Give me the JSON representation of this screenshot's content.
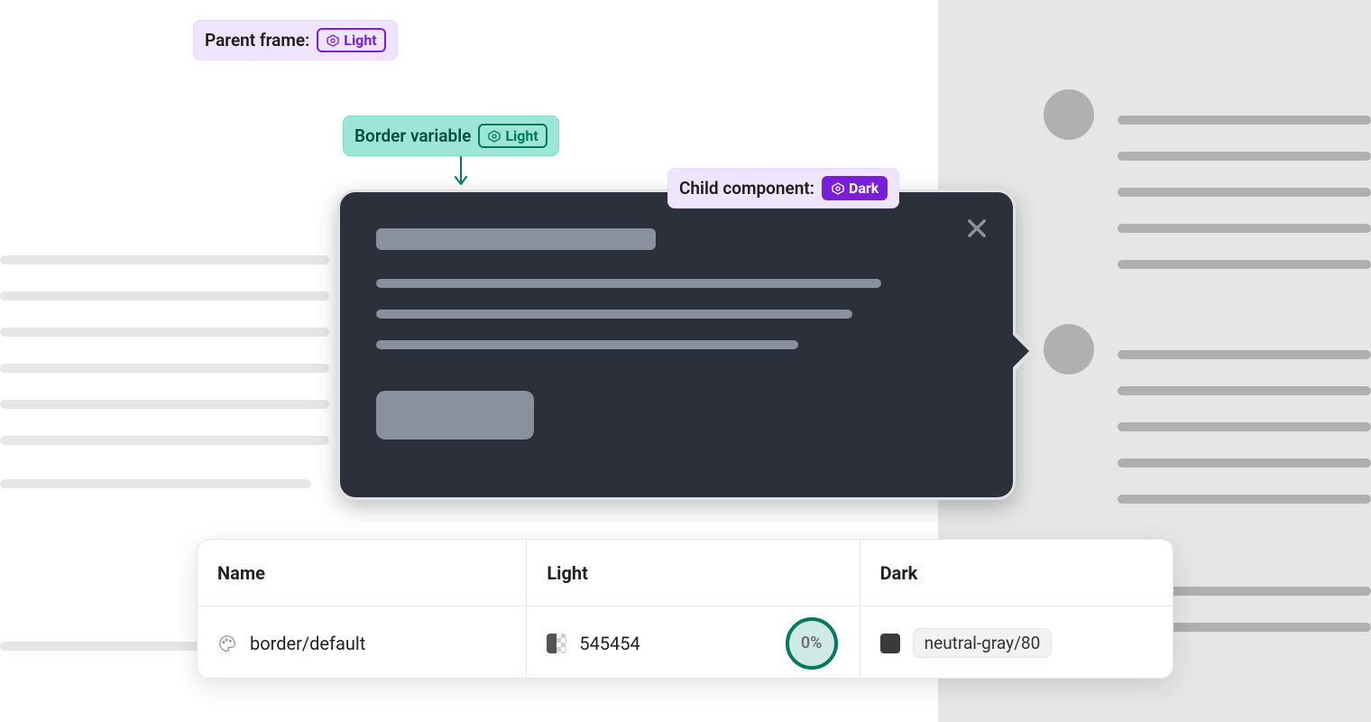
{
  "annotations": {
    "parent": {
      "label": "Parent frame:",
      "mode": "Light"
    },
    "border": {
      "label": "Border variable",
      "mode": "Light"
    },
    "child": {
      "label": "Child component:",
      "mode": "Dark"
    }
  },
  "table": {
    "headers": {
      "name": "Name",
      "light": "Light",
      "dark": "Dark"
    },
    "row": {
      "name": "border/default",
      "light_value": "545454",
      "opacity": "0%",
      "dark_pill": "neutral-gray/80"
    }
  },
  "colors": {
    "dark_card": "#2b303a",
    "teal": "#007a5e",
    "purple": "#7a1fd9",
    "swatch_light": "#545454",
    "swatch_dark": "#3a3a3a"
  }
}
